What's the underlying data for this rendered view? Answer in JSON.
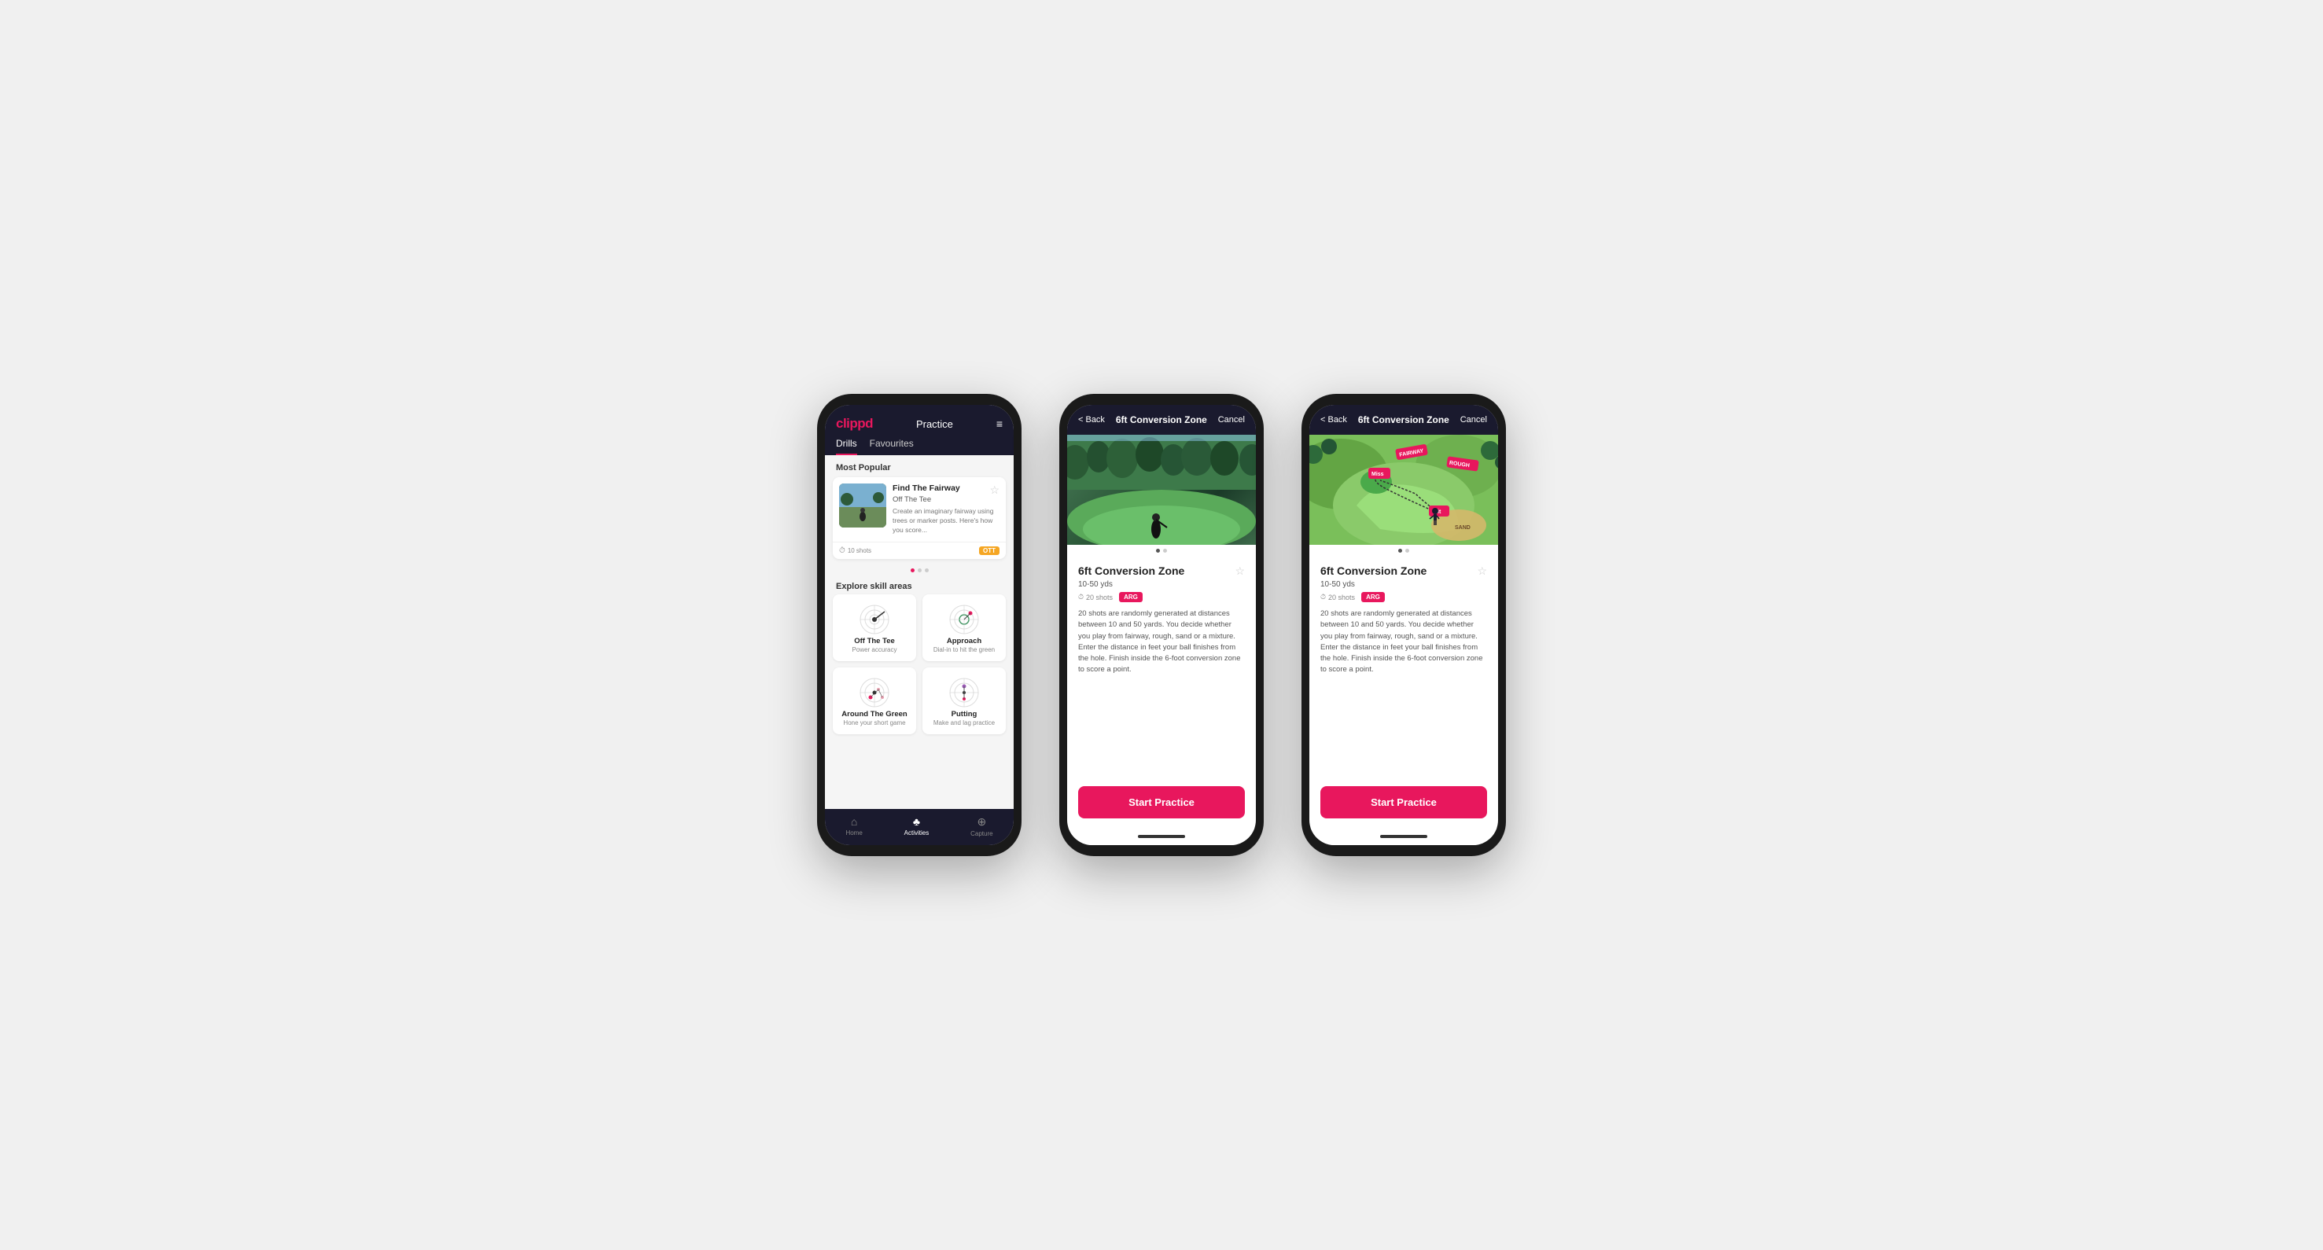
{
  "phone1": {
    "logo": "clippd",
    "nav_title": "Practice",
    "menu_icon": "≡",
    "tabs": [
      {
        "label": "Drills",
        "active": true
      },
      {
        "label": "Favourites",
        "active": false
      }
    ],
    "most_popular": "Most Popular",
    "card": {
      "title": "Find The Fairway",
      "subtitle": "Off The Tee",
      "desc": "Create an imaginary fairway using trees or marker posts. Here's how you score...",
      "shots": "10 shots",
      "tag": "OTT",
      "star": "☆"
    },
    "dots": [
      true,
      false,
      false
    ],
    "explore": "Explore skill areas",
    "skills": [
      {
        "name": "Off The Tee",
        "desc": "Power accuracy"
      },
      {
        "name": "Approach",
        "desc": "Dial-in to hit the green"
      },
      {
        "name": "Around The Green",
        "desc": "Hone your short game"
      },
      {
        "name": "Putting",
        "desc": "Make and lag practice"
      }
    ],
    "bottom_nav": [
      {
        "label": "Home",
        "icon": "⌂",
        "active": false
      },
      {
        "label": "Activities",
        "icon": "♣",
        "active": true
      },
      {
        "label": "Capture",
        "icon": "⊕",
        "active": false
      }
    ]
  },
  "phone2": {
    "back": "< Back",
    "title": "6ft Conversion Zone",
    "cancel": "Cancel",
    "drill_title": "6ft Conversion Zone",
    "drill_range": "10-50 yds",
    "shots": "20 shots",
    "tag": "ARG",
    "star": "☆",
    "dots": [
      true,
      false
    ],
    "description": "20 shots are randomly generated at distances between 10 and 50 yards. You decide whether you play from fairway, rough, sand or a mixture. Enter the distance in feet your ball finishes from the hole. Finish inside the 6-foot conversion zone to score a point.",
    "start_btn": "Start Practice",
    "hero_type": "photo"
  },
  "phone3": {
    "back": "< Back",
    "title": "6ft Conversion Zone",
    "cancel": "Cancel",
    "drill_title": "6ft Conversion Zone",
    "drill_range": "10-50 yds",
    "shots": "20 shots",
    "tag": "ARG",
    "star": "☆",
    "dots": [
      true,
      false
    ],
    "description": "20 shots are randomly generated at distances between 10 and 50 yards. You decide whether you play from fairway, rough, sand or a mixture. Enter the distance in feet your ball finishes from the hole. Finish inside the 6-foot conversion zone to score a point.",
    "start_btn": "Start Practice",
    "hero_type": "map"
  }
}
